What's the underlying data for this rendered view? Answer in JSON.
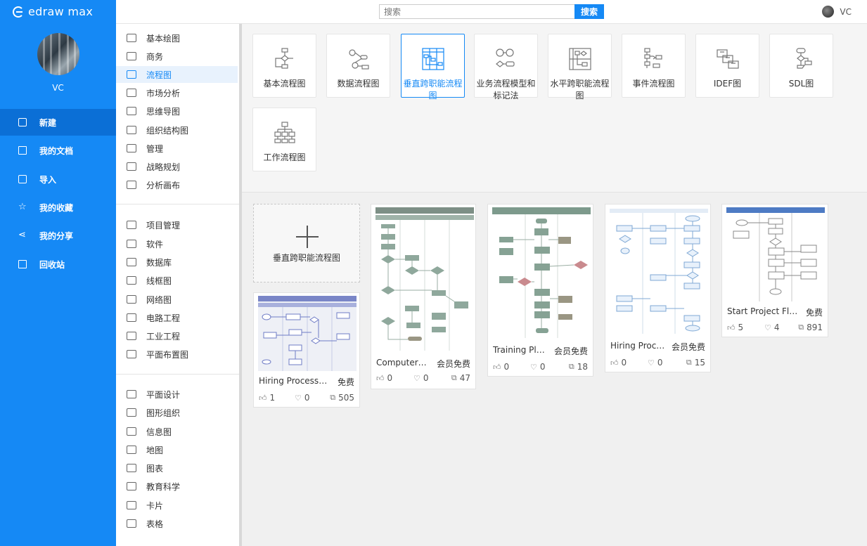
{
  "app": {
    "title": "edraw max"
  },
  "sidebar": {
    "user": "VC",
    "items": [
      {
        "label": "新建"
      },
      {
        "label": "我的文档"
      },
      {
        "label": "导入"
      },
      {
        "label": "我的收藏"
      },
      {
        "label": "我的分享"
      },
      {
        "label": "回收站"
      }
    ]
  },
  "topbar": {
    "search_placeholder": "搜索",
    "search_button": "搜索",
    "user": "VC"
  },
  "categories": {
    "group1": [
      "基本绘图",
      "商务",
      "流程图",
      "市场分析",
      "思维导图",
      "组织结构图",
      "管理",
      "战略规划",
      "分析画布"
    ],
    "group2": [
      "项目管理",
      "软件",
      "数据库",
      "线框图",
      "网络图",
      "电路工程",
      "工业工程",
      "平面布置图"
    ],
    "group3": [
      "平面设计",
      "图形组织",
      "信息图",
      "地图",
      "图表",
      "教育科学",
      "卡片",
      "表格"
    ]
  },
  "types": [
    {
      "line1": "基本流程图",
      "line2": ""
    },
    {
      "line1": "数据流程图",
      "line2": ""
    },
    {
      "line1": "垂直跨职能流程",
      "line2": "图"
    },
    {
      "line1": "业务流程模型和",
      "line2": "标记法"
    },
    {
      "line1": "水平跨职能流程",
      "line2": "图"
    },
    {
      "line1": "事件流程图",
      "line2": ""
    },
    {
      "line1": "IDEF图",
      "line2": ""
    },
    {
      "line1": "SDL图",
      "line2": ""
    },
    {
      "line1": "工作流程图",
      "line2": ""
    }
  ],
  "new_card": {
    "label": "垂直跨职能流程图"
  },
  "templates": [
    {
      "name": "Hiring Process Fl...",
      "price": "免费",
      "likes": "1",
      "favs": "0",
      "copies": "505"
    },
    {
      "name": "Computer ...",
      "price": "会员免费",
      "likes": "0",
      "favs": "0",
      "copies": "47"
    },
    {
      "name": "Training Pla...",
      "price": "会员免费",
      "likes": "0",
      "favs": "0",
      "copies": "18"
    },
    {
      "name": "Hiring Proce...",
      "price": "会员免费",
      "likes": "0",
      "favs": "0",
      "copies": "15"
    },
    {
      "name": "Start Project Flo...",
      "price": "免费",
      "likes": "5",
      "favs": "4",
      "copies": "891"
    }
  ],
  "colors": {
    "accent": "#1589f5",
    "accent_dark": "#0b6fd6"
  }
}
